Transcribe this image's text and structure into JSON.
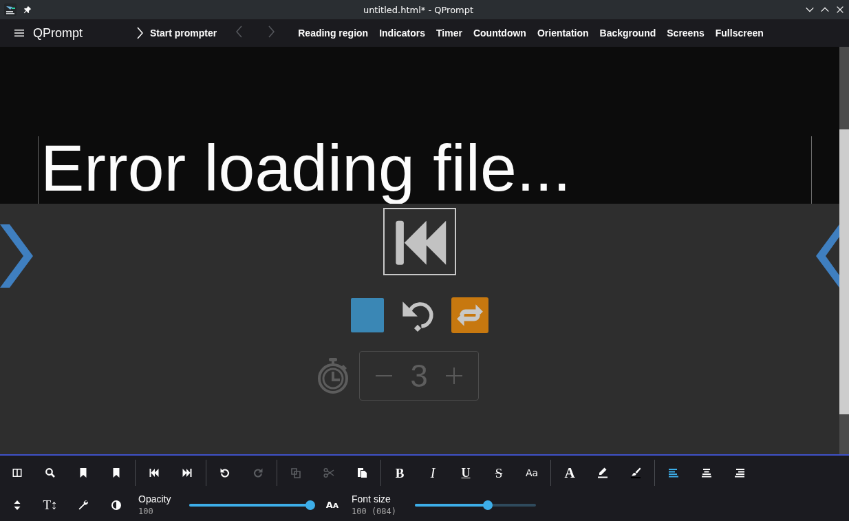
{
  "window": {
    "title": "untitled.html* - QPrompt"
  },
  "menubar": {
    "app_title": "QPrompt",
    "start": "Start prompter",
    "nav": [
      {
        "kind": "back",
        "disabled": true
      },
      {
        "kind": "forward",
        "disabled": true
      }
    ],
    "items": [
      "Reading region",
      "Indicators",
      "Timer",
      "Countdown",
      "Orientation",
      "Background",
      "Screens",
      "Fullscreen"
    ]
  },
  "editor": {
    "text": "Error loading file...",
    "countdown": {
      "value": "3"
    }
  },
  "toolbar": {
    "groups": [
      [
        {
          "kind": "panel",
          "disabled": false
        },
        {
          "kind": "search",
          "disabled": false
        },
        {
          "kind": "bookmark",
          "disabled": false
        },
        {
          "kind": "bookmark",
          "disabled": false
        }
      ],
      [
        {
          "kind": "skip-back",
          "disabled": false
        },
        {
          "kind": "skip-forward",
          "disabled": false
        }
      ],
      [
        {
          "kind": "undo",
          "disabled": false
        },
        {
          "kind": "redo",
          "disabled": true
        }
      ],
      [
        {
          "kind": "copy",
          "disabled": true
        },
        {
          "kind": "cut",
          "disabled": true
        },
        {
          "kind": "paste",
          "disabled": false
        }
      ],
      [
        {
          "kind": "bold",
          "glyph": "B",
          "disabled": false
        },
        {
          "kind": "italic",
          "glyph": "I",
          "disabled": false
        },
        {
          "kind": "underline",
          "glyph": "U",
          "disabled": false
        },
        {
          "kind": "strike",
          "glyph": "S",
          "disabled": false
        },
        {
          "kind": "case",
          "glyph": "Aa",
          "disabled": false
        }
      ],
      [
        {
          "kind": "font",
          "glyph": "A",
          "disabled": false
        },
        {
          "kind": "highlight",
          "disabled": false
        },
        {
          "kind": "brush",
          "disabled": false
        }
      ],
      [
        {
          "kind": "align-left",
          "selected": true,
          "disabled": false
        },
        {
          "kind": "align-center",
          "selected": false,
          "disabled": false
        },
        {
          "kind": "align-right",
          "selected": false,
          "disabled": false
        }
      ]
    ],
    "row2": [
      {
        "kind": "updown",
        "disabled": false
      },
      {
        "kind": "direction",
        "glyph": "T↕",
        "disabled": false
      },
      {
        "kind": "wrench",
        "disabled": false
      },
      {
        "kind": "contrast",
        "disabled": false
      }
    ],
    "opacity": {
      "label": "Opacity",
      "reading": "100",
      "level": 1
    },
    "size_tool": {
      "kind": "size",
      "glyph": "Aᴀ",
      "disabled": false
    },
    "font_size": {
      "label": "Font size",
      "reading": "100 (084)",
      "level": 0.6
    }
  }
}
